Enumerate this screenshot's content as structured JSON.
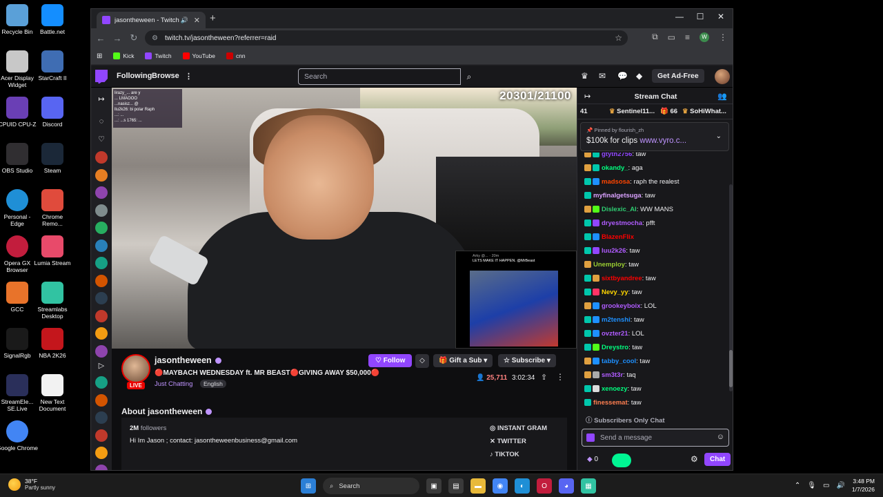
{
  "desktop": {
    "icons": [
      {
        "label": "Recycle Bin",
        "color": "#5aa0d8"
      },
      {
        "label": "Battle.net",
        "color": "#148eff"
      },
      {
        "label": "Acer Display Widget",
        "color": "#c8c8c8"
      },
      {
        "label": "StarCraft II",
        "color": "#3f6db3"
      },
      {
        "label": "CPUID CPU-Z",
        "color": "#6a3fb5"
      },
      {
        "label": "Discord",
        "color": "#5865f2"
      },
      {
        "label": "OBS Studio",
        "color": "#302e31"
      },
      {
        "label": "Steam",
        "color": "#1b2838"
      },
      {
        "label": "Personal - Edge",
        "color": "#1f8fd6"
      },
      {
        "label": "Chrome Remo...",
        "color": "#e04b3c"
      },
      {
        "label": "Opera GX Browser",
        "color": "#c21d3d"
      },
      {
        "label": "Lumia Stream",
        "color": "#e84a6a"
      },
      {
        "label": "GCC",
        "color": "#e8732a"
      },
      {
        "label": "Streamlabs Desktop",
        "color": "#31c3a2"
      },
      {
        "label": "SignalRgb",
        "color": "#1a1a1a"
      },
      {
        "label": "NBA 2K26",
        "color": "#c4161c"
      },
      {
        "label": "StreamEle... SE.Live",
        "color": "#2a2f5a"
      },
      {
        "label": "New Text Document",
        "color": "#f2f2f2"
      },
      {
        "label": "Google Chrome",
        "color": "#4285f4"
      }
    ]
  },
  "browser": {
    "tab_title": "jasontheween - Twitch",
    "url": "twitch.tv/jasontheween?referrer=raid",
    "bookmarks": [
      {
        "label": "Kick",
        "color": "#53fc18"
      },
      {
        "label": "Twitch",
        "color": "#9146ff"
      },
      {
        "label": "YouTube",
        "color": "#ff0000"
      },
      {
        "label": "cnn",
        "color": "#cc0000"
      }
    ],
    "profile_initial": "W"
  },
  "twitch": {
    "nav": {
      "following": "Following",
      "browse": "Browse",
      "search_placeholder": "Search",
      "get_adfree": "Get Ad-Free"
    },
    "video": {
      "counter": "20301/21100",
      "overlay_chat_lines": [
        "lirazy_... are y",
        "... LMAOOO",
        "...nasisz... @",
        "llu2k26: bi polar Raph",
        "...: ...",
        "...: ...s 1765: ..."
      ],
      "tweet_header": "Arky @... · 20m",
      "tweet_text": "LETS MAKE IT HAPPEN. @MrBeast"
    },
    "channel": {
      "name": "jasontheween",
      "live_label": "LIVE",
      "title": "🔴MAYBACH WEDNESDAY ft. MR BEAST🔴GIVING AWAY $50,000🔴",
      "category": "Just Chatting",
      "language": "English",
      "follow_label": "Follow",
      "gift_label": "Gift a Sub",
      "subscribe_label": "Subscribe",
      "viewers": "25,711",
      "uptime": "3:02:34",
      "about_title": "About jasontheween",
      "followers_count": "2M",
      "followers_label": "followers",
      "bio": "Hi Im Jason ; contact: jasontheweenbusiness@gmail.com",
      "socials": [
        "INSTANT GRAM",
        "TWITTER",
        "TIKTOK"
      ]
    },
    "chat": {
      "title": "Stream Chat",
      "leaderboard": [
        {
          "text": "41"
        },
        {
          "text": "Sentinel11..."
        },
        {
          "text": "66"
        },
        {
          "text": "SoHiWhat..."
        }
      ],
      "pinned_by": "Pinned by",
      "pinned_user": "flourish_zh",
      "pinned_msg": "$100k for clips",
      "pinned_link": "www.vyro.c...",
      "messages": [
        {
          "user": "gtyth2756",
          "text": ": taw",
          "color": "#9146ff",
          "b1": "#e0a040",
          "b2": "#00c7ac"
        },
        {
          "user": "okandy_",
          "text": ": aga",
          "color": "#00ff7f",
          "b1": "#e0a040",
          "b2": "#00c7ac"
        },
        {
          "user": "madsosa",
          "text": ": raph the realest",
          "color": "#ff4500",
          "b1": "#00c7ac",
          "b2": "#1e90ff"
        },
        {
          "user": "myfinalgetsuga",
          "text": ": taw",
          "color": "#daa2ff",
          "b1": "#00c7ac",
          "b2": ""
        },
        {
          "user": "Dislexic_AI",
          "text": ": WW MANS",
          "color": "#2ecc71",
          "b1": "#e0a040",
          "b2": "#53fc18"
        },
        {
          "user": "dryestmocha",
          "text": ": pfft",
          "color": "#b05cff",
          "b1": "#00c7ac",
          "b2": "#9146ff"
        },
        {
          "user": "BlazenFlix",
          "text": "",
          "color": "#ff0000",
          "b1": "#00c7ac",
          "b2": "#1e90ff"
        },
        {
          "user": "luu2k26",
          "text": ": taw",
          "color": "#b05cff",
          "b1": "#00c7ac",
          "b2": "#9146ff"
        },
        {
          "user": "Unemploy",
          "text": ": taw",
          "color": "#9acd32",
          "b1": "#e0a040",
          "b2": ""
        },
        {
          "user": "sixtbyandree",
          "text": ": taw",
          "color": "#ff0000",
          "b1": "#00c7ac",
          "b2": "#e0a040"
        },
        {
          "user": "Nevy_yy",
          "text": ": taw",
          "color": "#ffd700",
          "b1": "#00c7ac",
          "b2": "#ff3366"
        },
        {
          "user": "grookeyboix",
          "text": ": LOL",
          "color": "#b05cff",
          "b1": "#e0a040",
          "b2": "#1e90ff"
        },
        {
          "user": "m2tenshi",
          "text": ": taw",
          "color": "#1e90ff",
          "b1": "#00c7ac",
          "b2": "#1e90ff"
        },
        {
          "user": "ovzter21",
          "text": ": LOL",
          "color": "#b05cff",
          "b1": "#00c7ac",
          "b2": "#1e90ff"
        },
        {
          "user": "Dreystro",
          "text": ": taw",
          "color": "#00ff7f",
          "b1": "#00c7ac",
          "b2": "#53fc18"
        },
        {
          "user": "tabby_cool",
          "text": ": taw",
          "color": "#1e90ff",
          "b1": "#e0a040",
          "b2": "#1e90ff"
        },
        {
          "user": "sm3t3r",
          "text": ": taq",
          "color": "#b05cff",
          "b1": "#e0a040",
          "b2": "#aaaaaa"
        },
        {
          "user": "xenoezy",
          "text": ": taw",
          "color": "#00ff7f",
          "b1": "#00c7ac",
          "b2": "#dddddd"
        },
        {
          "user": "finessemat",
          "text": ": taw",
          "color": "#ff7f50",
          "b1": "#00c7ac",
          "b2": ""
        }
      ],
      "subs_only": "Subscribers Only Chat",
      "input_placeholder": "Send a message",
      "bits": "0",
      "chat_button": "Chat"
    }
  },
  "taskbar": {
    "temp": "38°F",
    "weather": "Partly sunny",
    "search": "Search",
    "time": "3:48 PM",
    "date": "1/7/2026"
  }
}
